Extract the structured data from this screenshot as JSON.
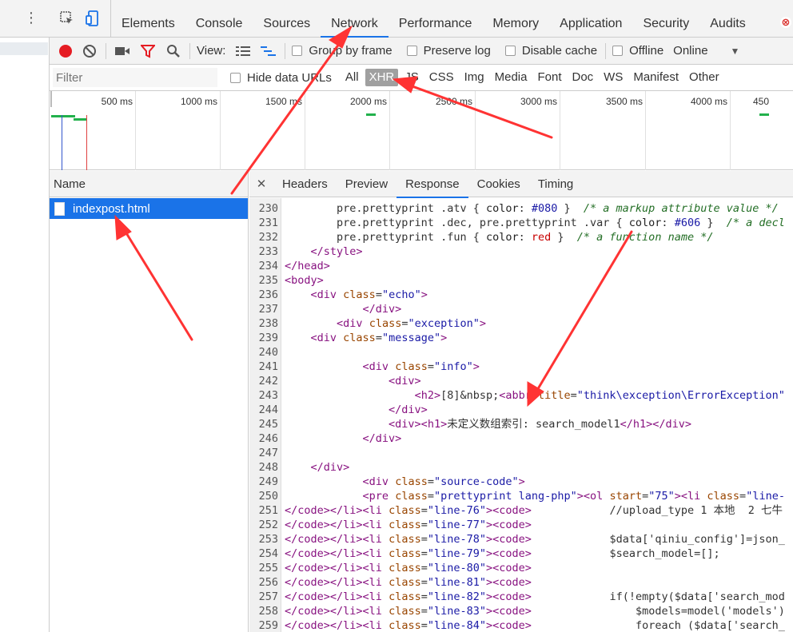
{
  "main_tabs": [
    "Elements",
    "Console",
    "Sources",
    "Network",
    "Performance",
    "Memory",
    "Application",
    "Security",
    "Audits"
  ],
  "active_main_tab": "Network",
  "toolbar": {
    "view_label": "View:",
    "group_by_frame": "Group by frame",
    "preserve_log": "Preserve log",
    "disable_cache": "Disable cache",
    "offline": "Offline",
    "throttle": "Online"
  },
  "filter": {
    "placeholder": "Filter",
    "hide_data_urls": "Hide data URLs",
    "types": [
      "All",
      "XHR",
      "JS",
      "CSS",
      "Img",
      "Media",
      "Font",
      "Doc",
      "WS",
      "Manifest",
      "Other"
    ],
    "active_type": "XHR"
  },
  "overview": {
    "labels": [
      "500 ms",
      "1000 ms",
      "1500 ms",
      "2000 ms",
      "2500 ms",
      "3000 ms",
      "3500 ms",
      "4000 ms",
      "450"
    ]
  },
  "requests": {
    "header": "Name",
    "items": [
      {
        "name": "indexpost.html",
        "selected": true
      }
    ]
  },
  "detail_tabs": [
    "Headers",
    "Preview",
    "Response",
    "Cookies",
    "Timing"
  ],
  "active_detail_tab": "Response",
  "code_lines": [
    {
      "n": "230",
      "html": "        pre.prettyprint .atv { <span class='k'>color</span>: <span class='v'>#080</span> }  <span class='c'>/* a markup attribute value */</span>"
    },
    {
      "n": "231",
      "html": "        pre.prettyprint .dec, pre.prettyprint .var { <span class='k'>color</span>: <span class='v'>#606</span> }  <span class='c'>/* a decl</span>"
    },
    {
      "n": "232",
      "html": "        pre.prettyprint .fun { <span class='k'>color</span>: <span class='r'>red</span> }  <span class='c'>/* a function name */</span>"
    },
    {
      "n": "233",
      "html": "    <span class='t'>&lt;/style&gt;</span>"
    },
    {
      "n": "234",
      "html": "<span class='t'>&lt;/head&gt;</span>"
    },
    {
      "n": "235",
      "html": "<span class='t'>&lt;body&gt;</span>"
    },
    {
      "n": "236",
      "html": "    <span class='t'>&lt;div</span> <span class='a'>class</span>=<span class='v'>\"echo\"</span><span class='t'>&gt;</span>"
    },
    {
      "n": "237",
      "html": "            <span class='t'>&lt;/div&gt;</span>"
    },
    {
      "n": "238",
      "html": "        <span class='t'>&lt;div</span> <span class='a'>class</span>=<span class='v'>\"exception\"</span><span class='t'>&gt;</span>"
    },
    {
      "n": "239",
      "html": "    <span class='t'>&lt;div</span> <span class='a'>class</span>=<span class='v'>\"message\"</span><span class='t'>&gt;</span>"
    },
    {
      "n": "240",
      "html": ""
    },
    {
      "n": "241",
      "html": "            <span class='t'>&lt;div</span> <span class='a'>class</span>=<span class='v'>\"info\"</span><span class='t'>&gt;</span>"
    },
    {
      "n": "242",
      "html": "                <span class='t'>&lt;div&gt;</span>"
    },
    {
      "n": "243",
      "html": "                    <span class='t'>&lt;h2&gt;</span>[8]&amp;nbsp;<span class='t'>&lt;abbr</span> <span class='a'>title</span>=<span class='v'>\"think\\exception\\ErrorException\"</span>"
    },
    {
      "n": "244",
      "html": "                <span class='t'>&lt;/div&gt;</span>"
    },
    {
      "n": "245",
      "html": "                <span class='t'>&lt;div&gt;&lt;h1&gt;</span>未定义数组索引: search_model1<span class='t'>&lt;/h1&gt;&lt;/div&gt;</span>"
    },
    {
      "n": "246",
      "html": "            <span class='t'>&lt;/div&gt;</span>"
    },
    {
      "n": "247",
      "html": ""
    },
    {
      "n": "248",
      "html": "    <span class='t'>&lt;/div&gt;</span>"
    },
    {
      "n": "249",
      "html": "            <span class='t'>&lt;div</span> <span class='a'>class</span>=<span class='v'>\"source-code\"</span><span class='t'>&gt;</span>"
    },
    {
      "n": "250",
      "html": "            <span class='t'>&lt;pre</span> <span class='a'>class</span>=<span class='v'>\"prettyprint lang-php\"</span><span class='t'>&gt;&lt;ol</span> <span class='a'>start</span>=<span class='v'>\"75\"</span><span class='t'>&gt;&lt;li</span> <span class='a'>class</span>=<span class='v'>\"line-</span>"
    },
    {
      "n": "251",
      "html": "<span class='t'>&lt;/code&gt;&lt;/li&gt;&lt;li</span> <span class='a'>class</span>=<span class='v'>\"line-76\"</span><span class='t'>&gt;&lt;code&gt;</span>            //upload_type 1 本地  2 七牛"
    },
    {
      "n": "252",
      "html": "<span class='t'>&lt;/code&gt;&lt;/li&gt;&lt;li</span> <span class='a'>class</span>=<span class='v'>\"line-77\"</span><span class='t'>&gt;&lt;code&gt;</span>"
    },
    {
      "n": "253",
      "html": "<span class='t'>&lt;/code&gt;&lt;/li&gt;&lt;li</span> <span class='a'>class</span>=<span class='v'>\"line-78\"</span><span class='t'>&gt;&lt;code&gt;</span>            $data['qiniu_config']=json_"
    },
    {
      "n": "254",
      "html": "<span class='t'>&lt;/code&gt;&lt;/li&gt;&lt;li</span> <span class='a'>class</span>=<span class='v'>\"line-79\"</span><span class='t'>&gt;&lt;code&gt;</span>            $search_model=[];"
    },
    {
      "n": "255",
      "html": "<span class='t'>&lt;/code&gt;&lt;/li&gt;&lt;li</span> <span class='a'>class</span>=<span class='v'>\"line-80\"</span><span class='t'>&gt;&lt;code&gt;</span>"
    },
    {
      "n": "256",
      "html": "<span class='t'>&lt;/code&gt;&lt;/li&gt;&lt;li</span> <span class='a'>class</span>=<span class='v'>\"line-81\"</span><span class='t'>&gt;&lt;code&gt;</span>"
    },
    {
      "n": "257",
      "html": "<span class='t'>&lt;/code&gt;&lt;/li&gt;&lt;li</span> <span class='a'>class</span>=<span class='v'>\"line-82\"</span><span class='t'>&gt;&lt;code&gt;</span>            if(!empty($data['search_mod"
    },
    {
      "n": "258",
      "html": "<span class='t'>&lt;/code&gt;&lt;/li&gt;&lt;li</span> <span class='a'>class</span>=<span class='v'>\"line-83\"</span><span class='t'>&gt;&lt;code&gt;</span>                $models=model('models')"
    },
    {
      "n": "259",
      "html": "<span class='t'>&lt;/code&gt;&lt;/li&gt;&lt;li</span> <span class='a'>class</span>=<span class='v'>\"line-84\"</span><span class='t'>&gt;&lt;code&gt;</span>                foreach ($data['search_"
    }
  ],
  "colors": {
    "accent": "#1a73e8",
    "record": "#e51c23",
    "arrow": "#ff3333",
    "green_bar": "#22b14c"
  }
}
